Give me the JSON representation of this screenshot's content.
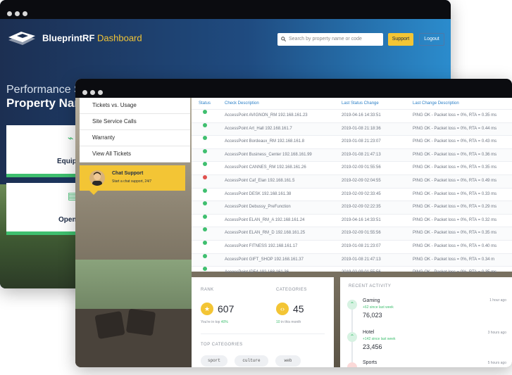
{
  "back_window": {
    "brand": "BlueprintRF",
    "brand_suffix": "Dashboard",
    "search_placeholder": "Search by property name or code",
    "support_label": "Support",
    "logout_label": "Logout",
    "hero_sub": "Performance S",
    "hero_title": "Property Nam",
    "card1_label": "Equipme",
    "card2_label": "Open"
  },
  "sidebar": {
    "items": [
      {
        "label": "Tickets vs. Usage"
      },
      {
        "label": "Site Service Calls"
      },
      {
        "label": "Warranty"
      },
      {
        "label": "View All Tickets"
      }
    ],
    "chat": {
      "title": "Chat Support",
      "subtitle": "Start a chat support, 24/7"
    }
  },
  "table": {
    "headers": [
      "Status",
      "Check Description",
      "Last Status Change",
      "Last Change Description"
    ],
    "rows": [
      {
        "status": "ok",
        "desc": "AccessPoint AVIGNON_RM 192.168.161.23",
        "time": "2019-04-16 14:33:51",
        "change": "PING OK - Packet loss = 0%, RTA = 0.35 ms"
      },
      {
        "status": "ok",
        "desc": "AccessPoint Art_Hall 192.168.161.7",
        "time": "2019-01-08 21:18:36",
        "change": "PING OK - Packet loss = 0%, RTA = 0.44 ms"
      },
      {
        "status": "ok",
        "desc": "AccessPoint Bordeaux_RM 192.168.161.8",
        "time": "2019-01-08 21:23:07",
        "change": "PING OK - Packet loss = 0%, RTA = 0.43 ms"
      },
      {
        "status": "ok",
        "desc": "AccessPoint Business_Center 192.168.161.99",
        "time": "2019-01-08 21:47:13",
        "change": "PING OK - Packet loss = 0%, RTA = 0.36 ms"
      },
      {
        "status": "ok",
        "desc": "AccessPoint CANNES_RM 192.168.161.26",
        "time": "2019-02-09 01:55:56",
        "change": "PING OK - Packet loss = 0%, RTA = 0.35 ms"
      },
      {
        "status": "error",
        "desc": "AccessPoint Caf_Elan 192.168.161.5",
        "time": "2019-02-09 02:04:55",
        "change": "PING OK - Packet loss = 0%, RTA = 0.49 ms"
      },
      {
        "status": "ok",
        "desc": "AccessPoint DESK 192.168.161.38",
        "time": "2019-02-09 02:33:45",
        "change": "PING OK - Packet loss = 0%, RTA = 0.33 ms"
      },
      {
        "status": "ok",
        "desc": "AccessPoint Debussy_PreFunction",
        "time": "2019-02-09 02:22:35",
        "change": "PING OK - Packet loss = 0%, RTA = 0.29 ms"
      },
      {
        "status": "ok",
        "desc": "AccessPoint ELAN_RM_A 192.168.161.24",
        "time": "2019-04-16 14:33:51",
        "change": "PING OK - Packet loss = 0%, RTA = 0.32 ms"
      },
      {
        "status": "ok",
        "desc": "AccessPoint ELAN_RM_D 192.168.161.25",
        "time": "2019-02-09 01:55:56",
        "change": "PING OK - Packet loss = 0%, RTA = 0.35 ms"
      },
      {
        "status": "ok",
        "desc": "AccessPoint FITNESS 192.168.161.17",
        "time": "2019-01-08 21:23:07",
        "change": "PING OK - Packet loss = 0%, RTA = 0.40 ms"
      },
      {
        "status": "ok",
        "desc": "AccessPoint GIFT_SHOP 192.168.161.37",
        "time": "2019-01-08 21:47:13",
        "change": "PING OK - Packet loss = 0%, RTA = 0.34 m"
      },
      {
        "status": "ok",
        "desc": "AccessPoint IDF4 192.168.161.36",
        "time": "2019-02-09 01:55:56",
        "change": "PING OK - Packet loss = 0%, RTA = 0.35 ms"
      }
    ]
  },
  "rank": {
    "rank_label": "RANK",
    "rank_value": "607",
    "rank_note_prefix": "You're in top",
    "rank_note_pct": "40%",
    "cat_label": "CATEGORIES",
    "cat_value": "45",
    "cat_note_num": "10",
    "cat_note_suffix": "in this month",
    "top_label": "TOP CATEGORIES",
    "chips": [
      "sport",
      "culture",
      "web"
    ]
  },
  "activity": {
    "label": "RECENT ACTIVITY",
    "items": [
      {
        "name": "Gaming",
        "delta": "+62",
        "delta_suffix": "since last week",
        "value": "76,023",
        "time": "1 hour ago"
      },
      {
        "name": "Hotel",
        "delta": "+142",
        "delta_suffix": "since last week",
        "value": "23,456",
        "time": "3 hours ago"
      },
      {
        "name": "Sports",
        "time": "5 hours ago"
      }
    ]
  },
  "colors": {
    "accent": "#f3c535",
    "ok": "#3fbf6f",
    "error": "#e0524f",
    "link": "#2a7fc7"
  }
}
